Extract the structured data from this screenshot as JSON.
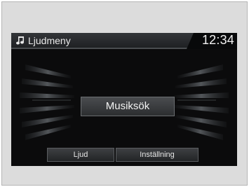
{
  "header": {
    "icon": "music-note-icon",
    "title": "Ljudmeny",
    "clock": "12:34"
  },
  "main": {
    "center_button_label": "Musiksök"
  },
  "footer": {
    "buttons": [
      {
        "label": "Ljud"
      },
      {
        "label": "Inställning"
      }
    ]
  },
  "colors": {
    "screen_bg": "#0b0b0c",
    "header_bg": "#2a2c2e",
    "text": "#f2f2f2",
    "frame_bg": "#dcdcdc"
  }
}
